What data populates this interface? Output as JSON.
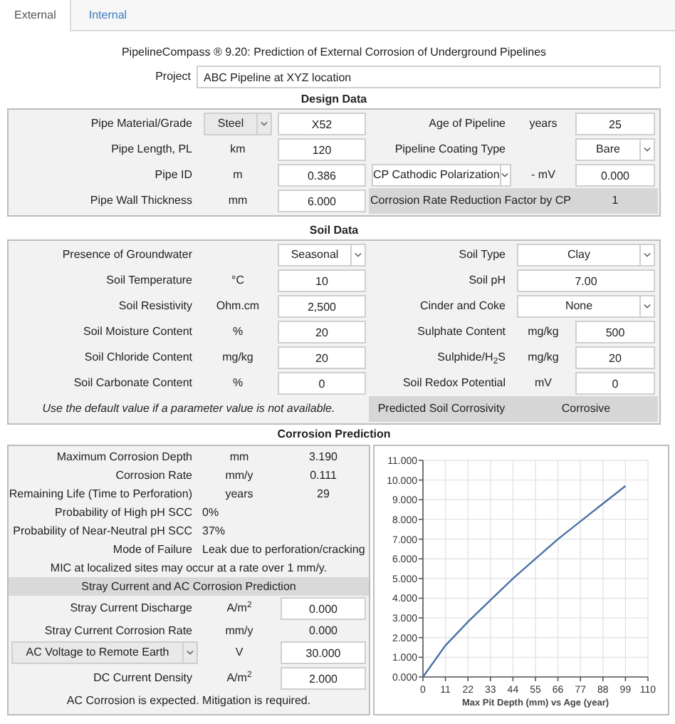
{
  "tabs": [
    {
      "label": "External",
      "selected": true
    },
    {
      "label": "Internal",
      "selected": false
    }
  ],
  "title": "PipelineCompass ® 9.20: Prediction of External Corrosion of Underground Pipelines",
  "project": {
    "label": "Project",
    "value": "ABC Pipeline at XYZ location"
  },
  "design": {
    "heading": "Design Data",
    "rows": [
      {
        "left": {
          "kind": "measure",
          "label": "Pipe Material/Grade",
          "unit": {
            "kind": "select",
            "text": "Steel",
            "disabled": true
          },
          "value": {
            "kind": "input",
            "text": "X52"
          }
        },
        "right": {
          "kind": "measure",
          "label": "Age of Pipeline",
          "unit": "years",
          "value": {
            "kind": "input",
            "text": "25"
          }
        }
      },
      {
        "left": {
          "kind": "measure",
          "label": "Pipe Length, PL",
          "unit": "km",
          "value": {
            "kind": "input",
            "text": "120"
          }
        },
        "right": {
          "kind": "measure",
          "label": "Pipeline Coating Type",
          "value": {
            "kind": "select",
            "text": "Bare",
            "disabled": false
          }
        }
      },
      {
        "left": {
          "kind": "measure",
          "label": "Pipe ID",
          "unit": "m",
          "value": {
            "kind": "input",
            "text": "0.386"
          }
        },
        "right": {
          "kind": "measure",
          "label": {
            "kind": "select",
            "text": "CP Cathodic Polarization",
            "disabled": false
          },
          "unit": "- mV",
          "value": {
            "kind": "input",
            "text": "0.000"
          }
        }
      },
      {
        "left": {
          "kind": "measure",
          "label": "Pipe Wall Thickness",
          "unit": "mm",
          "value": {
            "kind": "input",
            "text": "6.000"
          }
        },
        "right": {
          "kind": "factor",
          "label": "Corrosion Rate Reduction Factor by CP",
          "value": "1"
        }
      }
    ]
  },
  "soil": {
    "heading": "Soil Data",
    "rows": [
      {
        "left": {
          "kind": "measure",
          "label": "Presence of Groundwater",
          "value": {
            "kind": "select",
            "text": "Seasonal",
            "disabled": false
          }
        },
        "right": {
          "kind": "wide",
          "label": "Soil Type",
          "value": {
            "kind": "select",
            "text": "Clay",
            "disabled": false
          }
        }
      },
      {
        "left": {
          "kind": "measure",
          "label": "Soil Temperature",
          "unit": "°C",
          "value": {
            "kind": "input",
            "text": "10"
          }
        },
        "right": {
          "kind": "wide",
          "label": "Soil pH",
          "value": {
            "kind": "input",
            "text": "7.00"
          }
        }
      },
      {
        "left": {
          "kind": "measure",
          "label": "Soil Resistivity",
          "unit": "Ohm.cm",
          "value": {
            "kind": "input",
            "text": "2,500"
          }
        },
        "right": {
          "kind": "wide",
          "label": "Cinder and Coke",
          "value": {
            "kind": "select",
            "text": "None",
            "disabled": false
          }
        }
      },
      {
        "left": {
          "kind": "measure",
          "label": "Soil Moisture Content",
          "unit": "%",
          "value": {
            "kind": "input",
            "text": "20"
          }
        },
        "right": {
          "kind": "measure",
          "label": "Sulphate Content",
          "unit": "mg/kg",
          "value": {
            "kind": "input",
            "text": "500"
          }
        }
      },
      {
        "left": {
          "kind": "measure",
          "label": "Soil Chloride Content",
          "unit": "mg/kg",
          "value": {
            "kind": "input",
            "text": "20"
          }
        },
        "right": {
          "kind": "measure",
          "label": "Sulphide/H$_{2}$S",
          "unit": "mg/kg",
          "value": {
            "kind": "input",
            "text": "20"
          }
        }
      },
      {
        "left": {
          "kind": "measure",
          "label": "Soil Carbonate Content",
          "unit": "%",
          "value": {
            "kind": "input",
            "text": "0"
          }
        },
        "right": {
          "kind": "measure",
          "label": "Soil Redox Potential",
          "unit": "mV",
          "value": {
            "kind": "input",
            "text": "0"
          }
        }
      },
      {
        "left": {
          "kind": "hint",
          "text": "Use the default value if a parameter value is not available."
        },
        "right": {
          "kind": "result",
          "label": "Predicted Soil Corrosivity",
          "value": "Corrosive"
        }
      }
    ]
  },
  "prediction": {
    "heading": "Corrosion Prediction",
    "rows": [
      {
        "kind": "measure",
        "label": "Maximum Corrosion Depth",
        "unit": "mm",
        "value": "3.190"
      },
      {
        "kind": "measure",
        "label": "Corrosion Rate",
        "unit": "mm/y",
        "value": "0.111"
      },
      {
        "kind": "measure",
        "label": "Remaining Life (Time to Perforation)",
        "unit": "years",
        "value": "29"
      },
      {
        "kind": "wide",
        "label": "Probability of High pH SCC",
        "value": "0%"
      },
      {
        "kind": "wide",
        "label": "Probability of Near-Neutral pH SCC",
        "value": "37%"
      },
      {
        "kind": "wide",
        "label": "Mode of Failure",
        "value": "Leak due to perforation/cracking"
      },
      {
        "kind": "note",
        "text": "MIC at localized sites may occur at a rate over 1 mm/y."
      },
      {
        "kind": "header",
        "text": "Stray Current and AC Corrosion Prediction"
      },
      {
        "kind": "measure",
        "label": "Stray Current Discharge",
        "unit": "A/m$^{2}$",
        "value": {
          "kind": "input",
          "text": "0.000"
        }
      },
      {
        "kind": "measure",
        "label": "Stray Current Corrosion Rate",
        "unit": "mm/y",
        "value": "0.000"
      },
      {
        "kind": "measure",
        "label": {
          "kind": "select",
          "text": "AC Voltage to Remote Earth",
          "disabled": true
        },
        "unit": "V",
        "value": {
          "kind": "input",
          "text": "30.000"
        }
      },
      {
        "kind": "measure",
        "label": "DC Current Density",
        "unit": "A/m$^{2}$",
        "value": {
          "kind": "input",
          "text": "2.000"
        }
      },
      {
        "kind": "note",
        "text": "AC Corrosion is expected. Mitigation is required."
      }
    ],
    "chart_data": {
      "type": "line",
      "grid": true,
      "xlabel": "Max Pit Depth (mm) vs Age (year)",
      "x": [
        0,
        11,
        22,
        33,
        44,
        55,
        66,
        77,
        88,
        99
      ],
      "series": [
        {
          "color": "#4a72a8",
          "values": [
            0,
            1.6,
            2.8,
            3.9,
            5.0,
            6.0,
            7.0,
            7.9,
            8.8,
            9.7
          ]
        }
      ],
      "xlim": [
        0,
        110
      ],
      "ylim": [
        0,
        11
      ],
      "xticks": [
        0,
        11,
        22,
        33,
        44,
        55,
        66,
        77,
        88,
        99,
        110
      ],
      "yticks": [
        {
          "value": 0,
          "label": "0.000"
        },
        {
          "value": 1,
          "label": "1.000"
        },
        {
          "value": 2,
          "label": "2.000"
        },
        {
          "value": 3,
          "label": "3.000"
        },
        {
          "value": 4,
          "label": "4.000"
        },
        {
          "value": 5,
          "label": "5.000"
        },
        {
          "value": 6,
          "label": "6.000"
        },
        {
          "value": 7,
          "label": "7.000"
        },
        {
          "value": 8,
          "label": "8.000"
        },
        {
          "value": 9,
          "label": "9.000"
        },
        {
          "value": 10,
          "label": "10.000"
        },
        {
          "value": 11,
          "label": "11.000"
        }
      ]
    }
  }
}
